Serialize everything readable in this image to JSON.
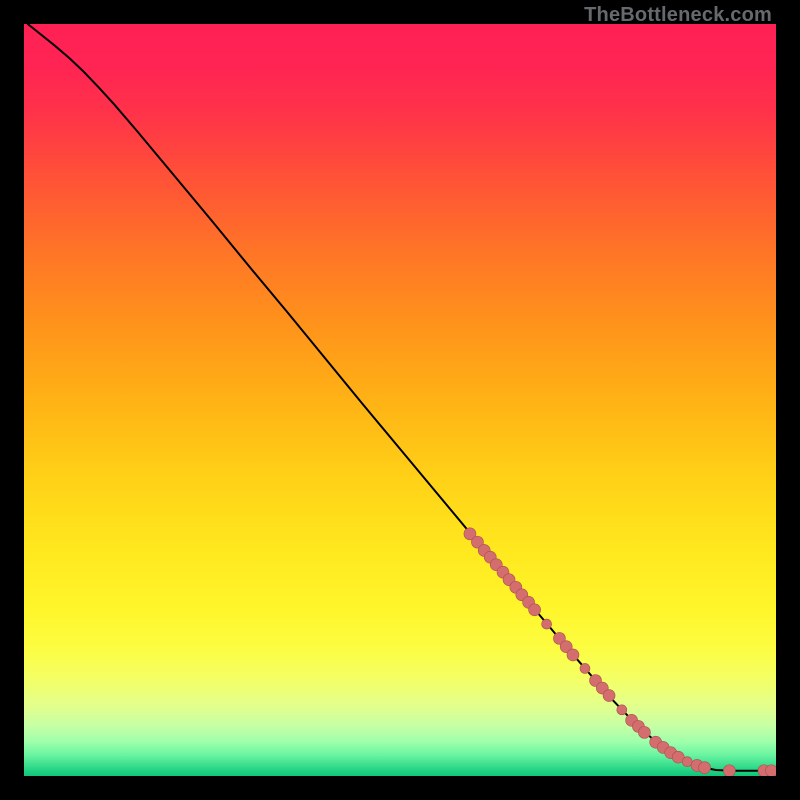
{
  "watermark": "TheBottleneck.com",
  "colors": {
    "bg": "#000000",
    "gradient_stops": [
      {
        "offset": 0.0,
        "color": "#ff2054"
      },
      {
        "offset": 0.06,
        "color": "#ff2553"
      },
      {
        "offset": 0.12,
        "color": "#ff3349"
      },
      {
        "offset": 0.2,
        "color": "#ff5038"
      },
      {
        "offset": 0.3,
        "color": "#ff7427"
      },
      {
        "offset": 0.4,
        "color": "#ff931b"
      },
      {
        "offset": 0.5,
        "color": "#ffb215"
      },
      {
        "offset": 0.6,
        "color": "#ffd017"
      },
      {
        "offset": 0.7,
        "color": "#ffe81e"
      },
      {
        "offset": 0.78,
        "color": "#fff62c"
      },
      {
        "offset": 0.83,
        "color": "#fcfd41"
      },
      {
        "offset": 0.87,
        "color": "#f4ff64"
      },
      {
        "offset": 0.905,
        "color": "#e3ff8a"
      },
      {
        "offset": 0.932,
        "color": "#c8ffa4"
      },
      {
        "offset": 0.955,
        "color": "#9effab"
      },
      {
        "offset": 0.972,
        "color": "#6af4a1"
      },
      {
        "offset": 0.985,
        "color": "#3de090"
      },
      {
        "offset": 0.994,
        "color": "#1ecf82"
      },
      {
        "offset": 1.0,
        "color": "#10c578"
      }
    ],
    "curve": "#000000",
    "point_fill": "#d46d6d",
    "point_stroke": "#a84f4f"
  },
  "chart_data": {
    "type": "line",
    "title": "",
    "xlabel": "",
    "ylabel": "",
    "xlim": [
      0,
      100
    ],
    "ylim": [
      0,
      100
    ],
    "grid": false,
    "curve": [
      {
        "x": 0.5,
        "y": 100.0
      },
      {
        "x": 2.0,
        "y": 98.8
      },
      {
        "x": 4.0,
        "y": 97.2
      },
      {
        "x": 6.0,
        "y": 95.5
      },
      {
        "x": 8.0,
        "y": 93.6
      },
      {
        "x": 10.0,
        "y": 91.5
      },
      {
        "x": 12.0,
        "y": 89.3
      },
      {
        "x": 15.0,
        "y": 85.8
      },
      {
        "x": 20.0,
        "y": 79.8
      },
      {
        "x": 25.0,
        "y": 73.8
      },
      {
        "x": 30.0,
        "y": 67.7
      },
      {
        "x": 35.0,
        "y": 61.7
      },
      {
        "x": 40.0,
        "y": 55.6
      },
      {
        "x": 45.0,
        "y": 49.5
      },
      {
        "x": 50.0,
        "y": 43.5
      },
      {
        "x": 55.0,
        "y": 37.5
      },
      {
        "x": 60.0,
        "y": 31.5
      },
      {
        "x": 65.0,
        "y": 25.6
      },
      {
        "x": 70.0,
        "y": 19.7
      },
      {
        "x": 72.0,
        "y": 17.3
      },
      {
        "x": 74.0,
        "y": 15.0
      },
      {
        "x": 76.0,
        "y": 12.7
      },
      {
        "x": 78.0,
        "y": 10.4
      },
      {
        "x": 80.0,
        "y": 8.3
      },
      {
        "x": 82.0,
        "y": 6.3
      },
      {
        "x": 84.0,
        "y": 4.6
      },
      {
        "x": 86.0,
        "y": 3.1
      },
      {
        "x": 88.0,
        "y": 2.0
      },
      {
        "x": 90.0,
        "y": 1.2
      },
      {
        "x": 92.0,
        "y": 0.8
      },
      {
        "x": 94.0,
        "y": 0.7
      },
      {
        "x": 96.0,
        "y": 0.7
      },
      {
        "x": 98.0,
        "y": 0.7
      },
      {
        "x": 99.6,
        "y": 0.7
      }
    ],
    "series": [
      {
        "name": "points",
        "type": "scatter",
        "points": [
          {
            "x": 59.3,
            "y": 32.2,
            "r": 6
          },
          {
            "x": 60.3,
            "y": 31.1,
            "r": 6
          },
          {
            "x": 61.2,
            "y": 30.0,
            "r": 6
          },
          {
            "x": 62.0,
            "y": 29.1,
            "r": 6
          },
          {
            "x": 62.8,
            "y": 28.1,
            "r": 6
          },
          {
            "x": 63.7,
            "y": 27.1,
            "r": 6
          },
          {
            "x": 64.5,
            "y": 26.1,
            "r": 6
          },
          {
            "x": 65.4,
            "y": 25.1,
            "r": 6
          },
          {
            "x": 66.2,
            "y": 24.1,
            "r": 6
          },
          {
            "x": 67.1,
            "y": 23.1,
            "r": 6
          },
          {
            "x": 67.9,
            "y": 22.1,
            "r": 6
          },
          {
            "x": 69.5,
            "y": 20.2,
            "r": 5
          },
          {
            "x": 71.2,
            "y": 18.3,
            "r": 6
          },
          {
            "x": 72.1,
            "y": 17.2,
            "r": 6
          },
          {
            "x": 73.0,
            "y": 16.1,
            "r": 6
          },
          {
            "x": 74.6,
            "y": 14.3,
            "r": 5
          },
          {
            "x": 76.0,
            "y": 12.7,
            "r": 6
          },
          {
            "x": 76.9,
            "y": 11.7,
            "r": 6
          },
          {
            "x": 77.8,
            "y": 10.7,
            "r": 6
          },
          {
            "x": 79.5,
            "y": 8.8,
            "r": 5
          },
          {
            "x": 80.8,
            "y": 7.4,
            "r": 6
          },
          {
            "x": 81.7,
            "y": 6.6,
            "r": 6
          },
          {
            "x": 82.5,
            "y": 5.8,
            "r": 6
          },
          {
            "x": 84.0,
            "y": 4.5,
            "r": 6
          },
          {
            "x": 85.0,
            "y": 3.8,
            "r": 6
          },
          {
            "x": 86.0,
            "y": 3.1,
            "r": 6
          },
          {
            "x": 87.0,
            "y": 2.5,
            "r": 6
          },
          {
            "x": 88.2,
            "y": 1.9,
            "r": 5
          },
          {
            "x": 89.5,
            "y": 1.4,
            "r": 6
          },
          {
            "x": 90.5,
            "y": 1.1,
            "r": 6
          },
          {
            "x": 93.8,
            "y": 0.7,
            "r": 6
          },
          {
            "x": 98.4,
            "y": 0.7,
            "r": 6
          },
          {
            "x": 99.4,
            "y": 0.7,
            "r": 6
          }
        ]
      }
    ]
  }
}
